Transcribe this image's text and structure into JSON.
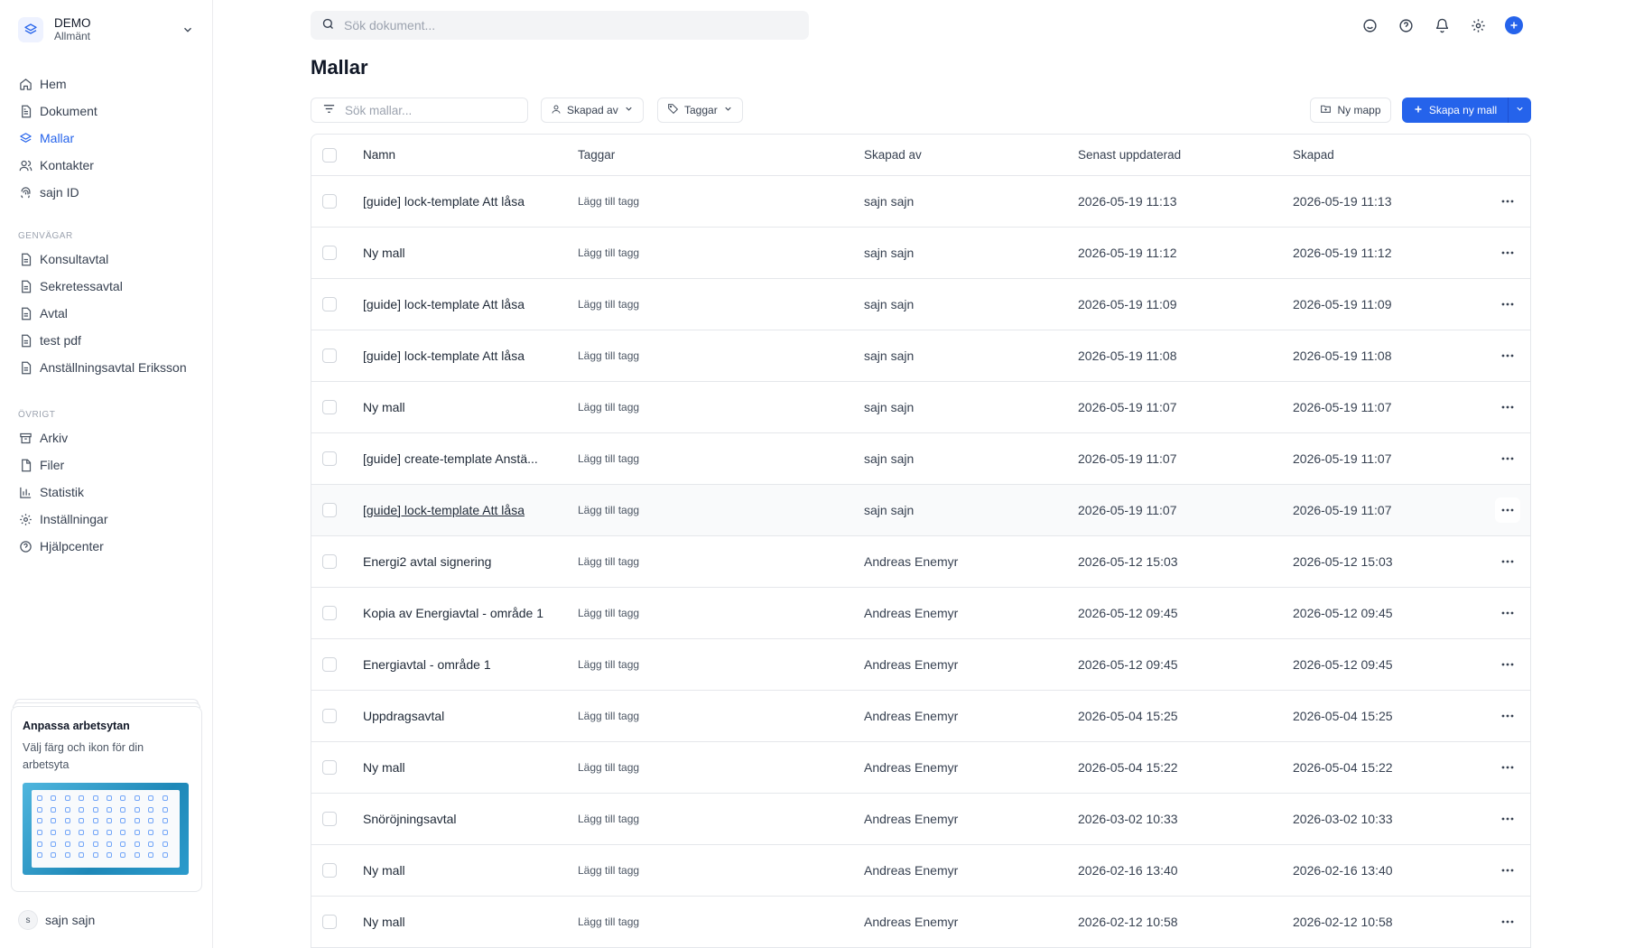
{
  "workspace": {
    "name": "DEMO",
    "subtitle": "Allmänt"
  },
  "search": {
    "placeholder": "Sök dokument..."
  },
  "nav": {
    "main": [
      {
        "label": "Hem",
        "icon": "home-icon"
      },
      {
        "label": "Dokument",
        "icon": "document-icon"
      },
      {
        "label": "Mallar",
        "icon": "layers-icon",
        "active": true
      },
      {
        "label": "Kontakter",
        "icon": "users-icon"
      },
      {
        "label": "sajn ID",
        "icon": "fingerprint-icon"
      }
    ],
    "shortcuts_title": "GENVÄGAR",
    "shortcuts": [
      {
        "label": "Konsultavtal"
      },
      {
        "label": "Sekretessavtal"
      },
      {
        "label": "Avtal"
      },
      {
        "label": "test pdf"
      },
      {
        "label": "Anställningsavtal Eriksson"
      }
    ],
    "other_title": "ÖVRIGT",
    "other": [
      {
        "label": "Arkiv",
        "icon": "archive-icon"
      },
      {
        "label": "Filer",
        "icon": "file-icon"
      },
      {
        "label": "Statistik",
        "icon": "chart-icon"
      },
      {
        "label": "Inställningar",
        "icon": "gear-icon"
      },
      {
        "label": "Hjälpcenter",
        "icon": "help-circle-icon"
      }
    ]
  },
  "promo": {
    "title": "Anpassa arbetsytan",
    "text": "Välj färg och ikon för din arbetsyta"
  },
  "user": {
    "initial": "s",
    "name": "sajn sajn"
  },
  "page": {
    "title": "Mallar"
  },
  "toolbar": {
    "filter_placeholder": "Sök mallar...",
    "created_by_label": "Skapad av",
    "tags_label": "Taggar",
    "new_folder_label": "Ny mapp",
    "create_label": "Skapa ny mall"
  },
  "table": {
    "headers": {
      "name": "Namn",
      "tags": "Taggar",
      "created_by": "Skapad av",
      "updated": "Senast uppdaterad",
      "created": "Skapad"
    },
    "rows": [
      {
        "name": "[guide] lock-template Att låsa",
        "tag": "Lägg till tagg",
        "by": "sajn sajn",
        "updated": "2026-05-19 11:13",
        "created": "2026-05-19 11:13"
      },
      {
        "name": "Ny mall",
        "tag": "Lägg till tagg",
        "by": "sajn sajn",
        "updated": "2026-05-19 11:12",
        "created": "2026-05-19 11:12"
      },
      {
        "name": "[guide] lock-template Att låsa",
        "tag": "Lägg till tagg",
        "by": "sajn sajn",
        "updated": "2026-05-19 11:09",
        "created": "2026-05-19 11:09"
      },
      {
        "name": "[guide] lock-template Att låsa",
        "tag": "Lägg till tagg",
        "by": "sajn sajn",
        "updated": "2026-05-19 11:08",
        "created": "2026-05-19 11:08"
      },
      {
        "name": "Ny mall",
        "tag": "Lägg till tagg",
        "by": "sajn sajn",
        "updated": "2026-05-19 11:07",
        "created": "2026-05-19 11:07"
      },
      {
        "name": "[guide] create-template Anstä...",
        "tag": "Lägg till tagg",
        "by": "sajn sajn",
        "updated": "2026-05-19 11:07",
        "created": "2026-05-19 11:07"
      },
      {
        "name": "[guide] lock-template Att låsa",
        "tag": "Lägg till tagg",
        "by": "sajn sajn",
        "updated": "2026-05-19 11:07",
        "created": "2026-05-19 11:07",
        "hover": true
      },
      {
        "name": "Energi2 avtal signering",
        "tag": "Lägg till tagg",
        "by": "Andreas Enemyr",
        "updated": "2026-05-12 15:03",
        "created": "2026-05-12 15:03"
      },
      {
        "name": "Kopia av Energiavtal - område 1",
        "tag": "Lägg till tagg",
        "by": "Andreas Enemyr",
        "updated": "2026-05-12 09:45",
        "created": "2026-05-12 09:45"
      },
      {
        "name": "Energiavtal - område 1",
        "tag": "Lägg till tagg",
        "by": "Andreas Enemyr",
        "updated": "2026-05-12 09:45",
        "created": "2026-05-12 09:45"
      },
      {
        "name": "Uppdragsavtal",
        "tag": "Lägg till tagg",
        "by": "Andreas Enemyr",
        "updated": "2026-05-04 15:25",
        "created": "2026-05-04 15:25"
      },
      {
        "name": "Ny mall",
        "tag": "Lägg till tagg",
        "by": "Andreas Enemyr",
        "updated": "2026-05-04 15:22",
        "created": "2026-05-04 15:22"
      },
      {
        "name": "Snöröjningsavtal",
        "tag": "Lägg till tagg",
        "by": "Andreas Enemyr",
        "updated": "2026-03-02 10:33",
        "created": "2026-03-02 10:33"
      },
      {
        "name": "Ny mall",
        "tag": "Lägg till tagg",
        "by": "Andreas Enemyr",
        "updated": "2026-02-16 13:40",
        "created": "2026-02-16 13:40"
      },
      {
        "name": "Ny mall",
        "tag": "Lägg till tagg",
        "by": "Andreas Enemyr",
        "updated": "2026-02-12 10:58",
        "created": "2026-02-12 10:58"
      }
    ]
  },
  "colors": {
    "accent": "#2563eb",
    "border": "#e5e7eb",
    "muted": "#9ca3af"
  }
}
